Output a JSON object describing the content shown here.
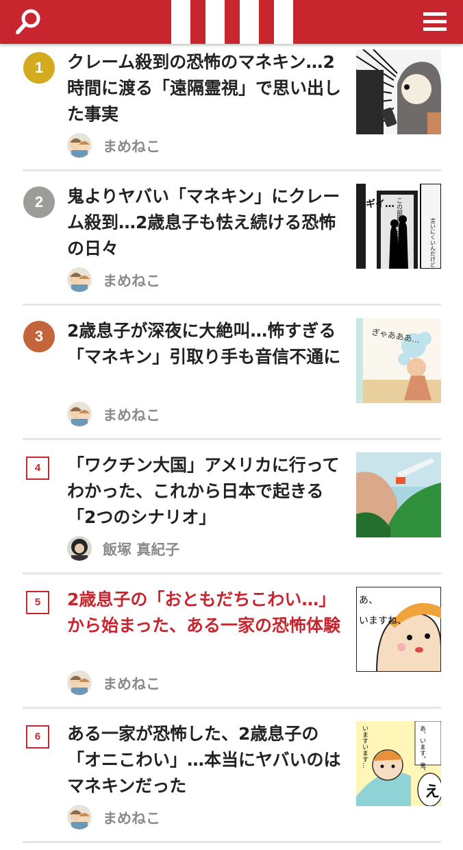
{
  "header": {
    "search_icon": "search-icon",
    "menu_icon": "hamburger-menu-icon",
    "brand_color": "#c8262f"
  },
  "articles": [
    {
      "rank": "1",
      "rank_style": "circle",
      "rank_color": "#d4ab1f",
      "title": "クレーム殺到の恐怖のマネキン…2時間に渡る「遠隔霊視」で思い出した事実",
      "author": "まめねこ"
    },
    {
      "rank": "2",
      "rank_style": "circle",
      "rank_color": "#9c9d99",
      "title": "鬼よりヤバい「マネキン」にクレーム殺到…2歳息子も怯え続ける恐怖の日々",
      "author": "まめねこ"
    },
    {
      "rank": "3",
      "rank_style": "circle",
      "rank_color": "#c4643a",
      "title": "2歳息子が深夜に大絶叫…怖すぎる「マネキン」引取り手も音信不通に",
      "author": "まめねこ"
    },
    {
      "rank": "4",
      "rank_style": "box",
      "title": "「ワクチン大国」アメリカに行ってわかった、これから日本で起きる「2つのシナリオ」",
      "author": "飯塚 真紀子"
    },
    {
      "rank": "5",
      "rank_style": "box",
      "title": "2歳息子の「おともだちこわい…」から始まった、ある一家の恐怖体験",
      "author": "まめねこ"
    },
    {
      "rank": "6",
      "rank_style": "box",
      "title": "ある一家が恐怖した、2歳息子の「オニこわい」…本当にヤバいのはマネキンだった",
      "author": "まめねこ"
    }
  ],
  "thumbnails": {
    "1": {
      "caption": ""
    },
    "2": {
      "caption_a": "ギイ…",
      "caption_b": "この部屋の…ね…",
      "caption_c": "言いにくいんだけど"
    },
    "3": {
      "caption": "ぎゃあああ…"
    },
    "4": {
      "caption": ""
    },
    "5": {
      "caption_a": "あ、",
      "caption_b": "いますね、"
    },
    "6": {
      "caption_a": "あ、います。鬼、",
      "caption_b": "いますいます…",
      "caption_c": "え"
    }
  }
}
